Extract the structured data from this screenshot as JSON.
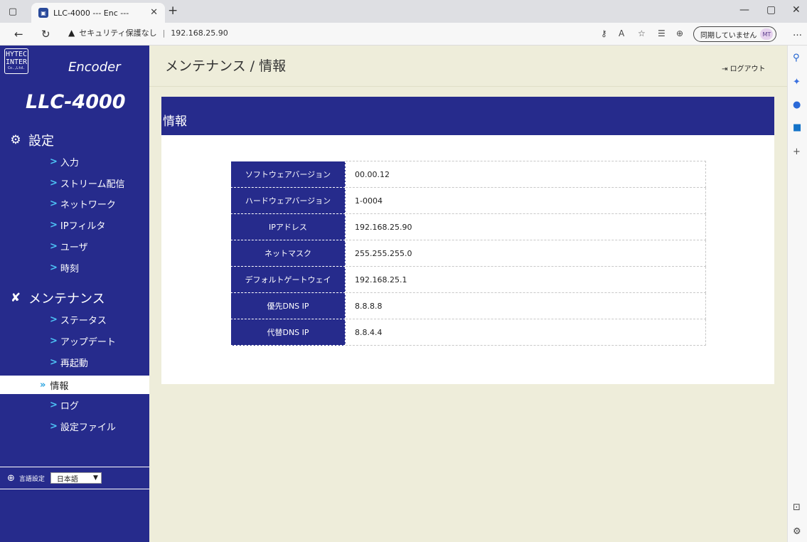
{
  "browser": {
    "tab_title": "LLC-4000 --- Enc ---",
    "security_label": "セキュリティ保護なし",
    "url": "192.168.25.90",
    "sync_label": "同期していません",
    "profile_initials": "MT"
  },
  "sidebar": {
    "logo_lines": [
      "HYTEC",
      "INTER",
      "Co.,Ltd."
    ],
    "brand": "Encoder",
    "model": "LLC-4000",
    "sections": [
      {
        "title": "設定",
        "items": [
          "入力",
          "ストリーム配信",
          "ネットワーク",
          "IPフィルタ",
          "ユーザ",
          "時刻"
        ]
      },
      {
        "title": "メンテナンス",
        "items": [
          "ステータス",
          "アップデート",
          "再起動",
          "情報",
          "ログ",
          "設定ファイル"
        ]
      }
    ],
    "active_item": "情報",
    "language_label": "言語設定",
    "language_value": "日本語"
  },
  "main": {
    "page_title": "メンテナンス / 情報",
    "logout_label": "ログアウト",
    "panel_title": "情報",
    "info": [
      {
        "key": "ソフトウェアバージョン",
        "value": "00.00.12"
      },
      {
        "key": "ハードウェアバージョン",
        "value": "1-0004"
      },
      {
        "key": "IPアドレス",
        "value": "192.168.25.90"
      },
      {
        "key": "ネットマスク",
        "value": "255.255.255.0"
      },
      {
        "key": "デフォルトゲートウェイ",
        "value": "192.168.25.1"
      },
      {
        "key": "優先DNS IP",
        "value": "8.8.8.8"
      },
      {
        "key": "代替DNS IP",
        "value": "8.8.4.4"
      }
    ]
  },
  "colors": {
    "sidebar_bg": "#262b8c",
    "main_bg": "#eeedda",
    "chevron": "#4dc3f5"
  }
}
